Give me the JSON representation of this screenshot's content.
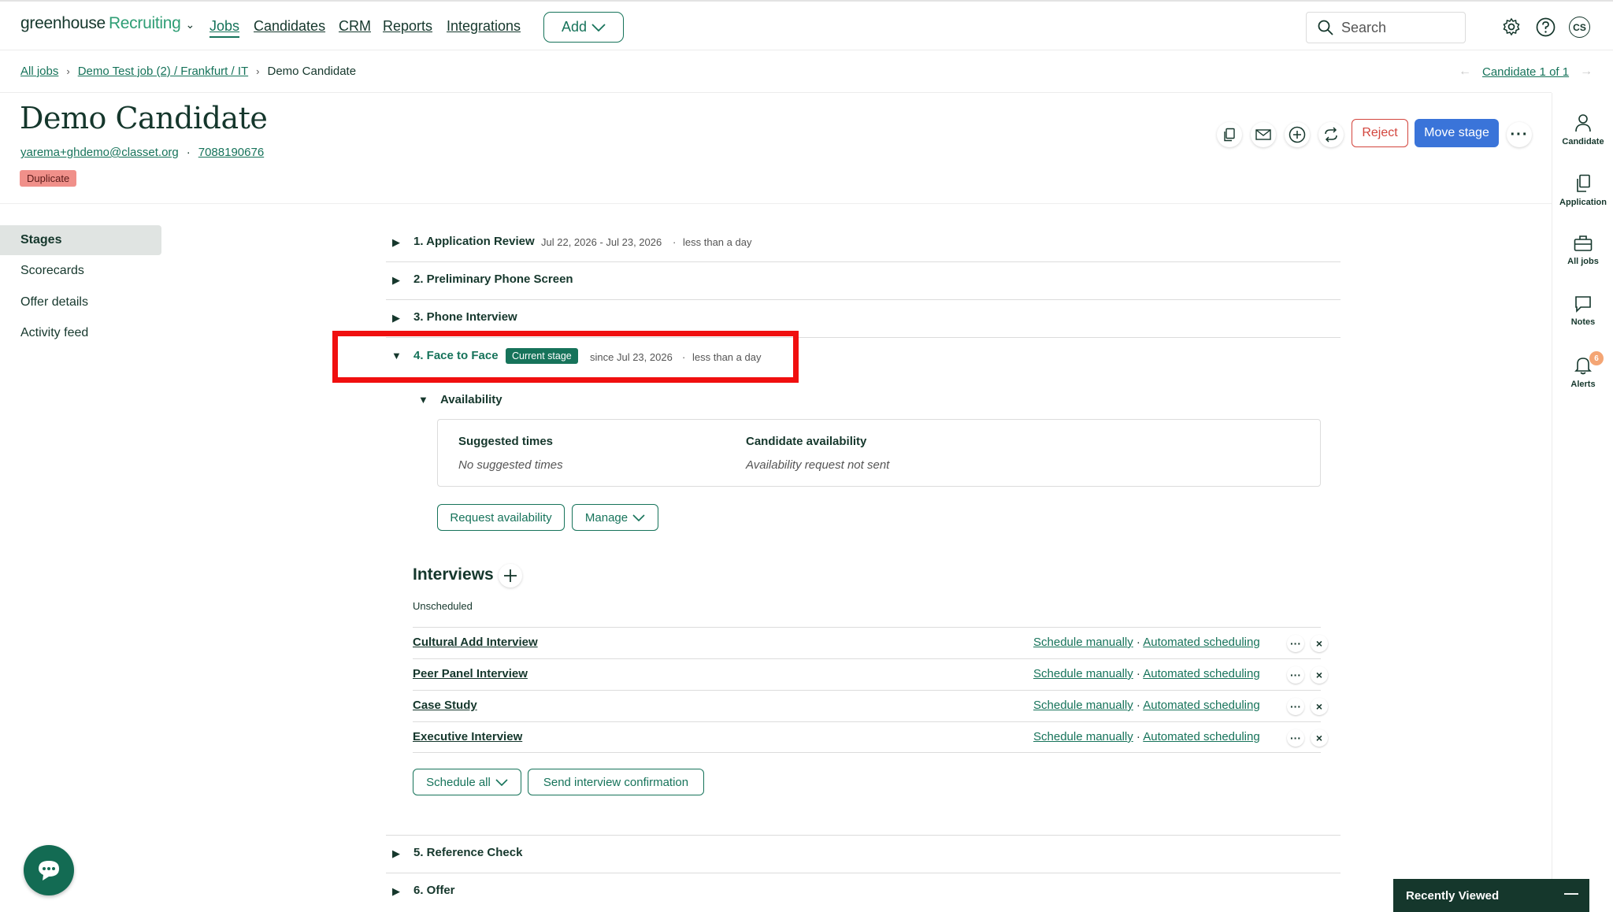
{
  "app": {
    "logo_part1": "greenhouse",
    "logo_part2": "Recruiting",
    "nav": [
      "Jobs",
      "Candidates",
      "CRM",
      "Reports",
      "Integrations"
    ],
    "add_label": "Add",
    "search_placeholder": "Search",
    "avatar_initials": "CS"
  },
  "breadcrumb": {
    "all_jobs": "All jobs",
    "job": "Demo Test job (2) / Frankfurt / IT",
    "current": "Demo Candidate",
    "candidate_count": "Candidate 1 of 1"
  },
  "candidate": {
    "name": "Demo Candidate",
    "email": "yarema+ghdemo@classet.org",
    "phone": "7088190676",
    "badge": "Duplicate"
  },
  "actions": {
    "reject": "Reject",
    "move_stage": "Move stage"
  },
  "sidebar": [
    "Stages",
    "Scorecards",
    "Offer details",
    "Activity feed"
  ],
  "rail": [
    {
      "label": "Candidate",
      "icon": "person-icon"
    },
    {
      "label": "Application",
      "icon": "document-icon"
    },
    {
      "label": "All jobs",
      "icon": "briefcase-icon"
    },
    {
      "label": "Notes",
      "icon": "comment-icon"
    },
    {
      "label": "Alerts",
      "icon": "bell-icon",
      "count": "6"
    }
  ],
  "stages": {
    "s1": {
      "name": "1. Application Review",
      "dates": "Jul 22, 2026 - Jul 23, 2026",
      "duration": "less than a day"
    },
    "s2": {
      "name": "2. Preliminary Phone Screen"
    },
    "s3": {
      "name": "3. Phone Interview"
    },
    "s4": {
      "name": "4. Face to Face",
      "badge": "Current stage",
      "since": "since Jul 23, 2026",
      "duration": "less than a day"
    },
    "s5": {
      "name": "5. Reference Check"
    },
    "s6": {
      "name": "6. Offer"
    },
    "separator": "·"
  },
  "availability": {
    "title": "Availability",
    "suggested_label": "Suggested times",
    "suggested_value": "No suggested times",
    "candidate_label": "Candidate availability",
    "candidate_value": "Availability request not sent",
    "request_btn": "Request availability",
    "manage_btn": "Manage"
  },
  "interviews": {
    "title": "Interviews",
    "unscheduled": "Unscheduled",
    "schedule_manually": "Schedule manually",
    "automated_scheduling": "Automated scheduling",
    "items": [
      "Cultural Add Interview",
      "Peer Panel Interview",
      "Case Study",
      "Executive Interview"
    ],
    "schedule_all": "Schedule all",
    "send_confirmation": "Send interview confirmation"
  },
  "footer": {
    "recently_viewed": "Recently Viewed"
  },
  "colors": {
    "brand_green": "#16735a",
    "primary_blue": "#3a74d9",
    "reject_red": "#d3453d",
    "highlight_red": "#f00f0f"
  }
}
